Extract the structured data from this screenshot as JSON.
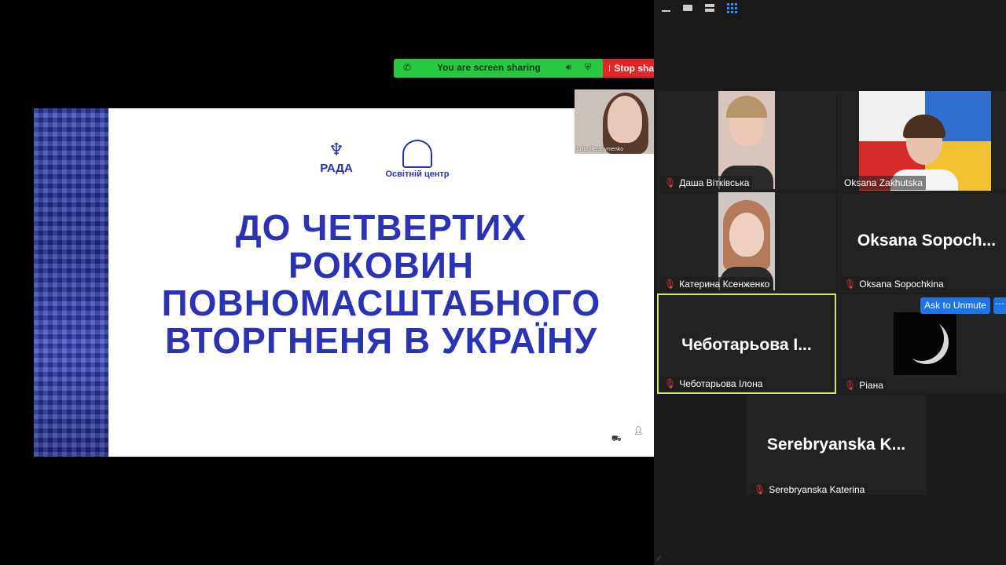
{
  "share_bar": {
    "status": "You are screen sharing",
    "stop_label": "Stop sha"
  },
  "slide": {
    "logo_left": "РАДА",
    "logo_right": "Освітній центр",
    "headline_lines": [
      "ДО ЧЕТВЕРТИХ",
      "РОКОВИН",
      "ПОВНОМАСШТАБНОГО",
      "ВТОРГНЕНЯ В УКРАЇНУ"
    ]
  },
  "presenter": {
    "name": "Liliia Herasymenko"
  },
  "gallery": {
    "participants": [
      {
        "name": "Даша Вітківська",
        "muted": true
      },
      {
        "name": "Oksana Zakhutska",
        "muted": false
      },
      {
        "name": "Катерина Ксенженко",
        "muted": true
      },
      {
        "name": "Oksana Sopochkina",
        "display": "Oksana  Sopoch...",
        "muted": true
      },
      {
        "name": "Чеботарьова Ілона",
        "display": "Чеботарьова І...",
        "muted": true,
        "active_speaker": true
      },
      {
        "name": "Ріана",
        "muted": true
      },
      {
        "name": "Serebryanska Katerina",
        "display": "Serebryanska  K...",
        "muted": true
      }
    ],
    "ask_to_unmute": "Ask to Unmute",
    "more_icon": "⋯"
  },
  "colors": {
    "share_green": "#28c840",
    "stop_red": "#e0262b",
    "slide_blue": "#2a33b4",
    "active_border": "#d8e36e",
    "button_blue": "#1e74e8",
    "mute_red": "#e8383d"
  }
}
